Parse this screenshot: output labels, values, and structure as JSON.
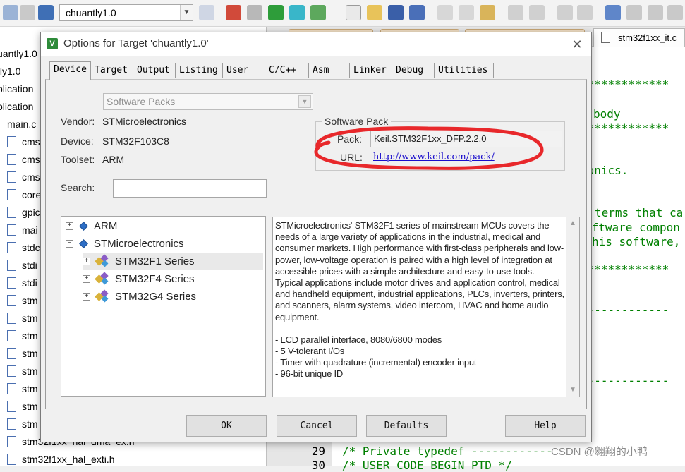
{
  "ide": {
    "target_name": "chuantly1.0",
    "project_items": [
      "uantly1.0",
      "tly1.0",
      "plication",
      "plication",
      "main.c",
      "cms",
      "cms",
      "cms",
      "core",
      "gpic",
      "mai",
      "stdc",
      "stdi",
      "stdi",
      "stm",
      "stm",
      "stm",
      "stm",
      "stm",
      "stm",
      "stm",
      "stm",
      "stm32f1xx_hal_dma_ex.h",
      "stm32f1xx_hal_exti.h"
    ],
    "editor_tab": "stm32f1xx_it.c",
    "code_lines": [
      "*************",
      "body",
      "*************",
      "ronics.",
      "terms that ca",
      "oftware compon",
      "his software,",
      "*************",
      "-------------",
      "-------------"
    ],
    "bottom_code": [
      {
        "no": "29",
        "text": "/* Private typedef ------------"
      },
      {
        "no": "30",
        "text": "/* USER CODE BEGIN PTD */"
      }
    ],
    "watermark": "CSDN @翱翔的小鸭"
  },
  "dialog": {
    "title": "Options for Target 'chuantly1.0'",
    "close_icon": "close-icon",
    "tabs": [
      "Device",
      "Target",
      "Output",
      "Listing",
      "User",
      "C/C++",
      "Asm",
      "Linker",
      "Debug",
      "Utilities"
    ],
    "active_tab": "Device",
    "database_select": "Software Packs",
    "vendor_label": "Vendor:",
    "vendor_value": "STMicroelectronics",
    "device_label": "Device:",
    "device_value": "STM32F103C8",
    "toolset_label": "Toolset:",
    "toolset_value": "ARM",
    "search_label": "Search:",
    "search_value": "",
    "software_pack": {
      "legend": "Software Pack",
      "pack_label": "Pack:",
      "pack_value": "Keil.STM32F1xx_DFP.2.2.0",
      "url_label": "URL:",
      "url_value": "http://www.keil.com/pack/"
    },
    "annotation_color": "#e8282b",
    "tree": [
      {
        "label": "ARM",
        "expander": "+",
        "level": 0
      },
      {
        "label": "STMicroelectronics",
        "expander": "−",
        "level": 0
      },
      {
        "label": "STM32F1 Series",
        "expander": "+",
        "level": 1,
        "selected": true
      },
      {
        "label": "STM32F4 Series",
        "expander": "+",
        "level": 1
      },
      {
        "label": "STM32G4 Series",
        "expander": "+",
        "level": 1
      }
    ],
    "description": {
      "paragraphs": [
        "STMicroelectronics' STM32F1 series of mainstream MCUs covers the needs of a large variety of applications in the industrial, medical and consumer markets. High performance with first-class peripherals and low-power, low-voltage operation is paired with a high level of integration at accessible prices with a simple architecture and easy-to-use tools.",
        "Typical applications include motor drives and application control, medical and handheld equipment, industrial applications, PLCs, inverters, printers, and scanners, alarm systems, video intercom, HVAC and home audio equipment."
      ],
      "bullets": [
        "- LCD parallel interface, 8080/6800 modes",
        "- 5 V-tolerant I/Os",
        "- Timer with quadrature (incremental) encoder input",
        "- 96-bit unique ID"
      ]
    },
    "buttons": [
      "OK",
      "Cancel",
      "Defaults",
      "Help"
    ]
  }
}
